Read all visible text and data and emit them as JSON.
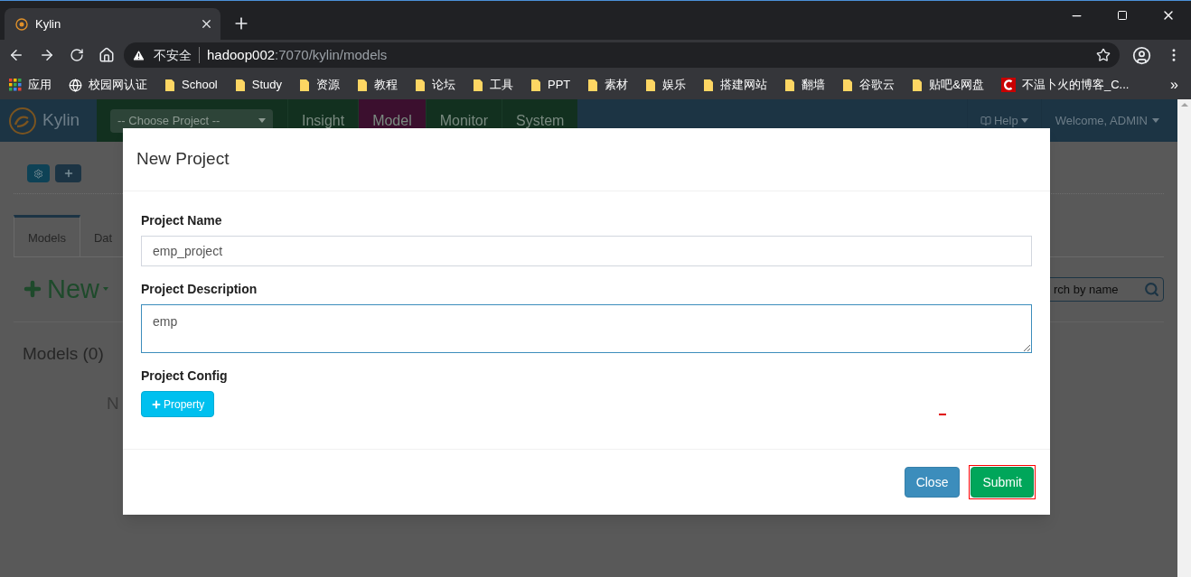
{
  "browser": {
    "tab": {
      "title": "Kylin"
    },
    "address": {
      "security": "不安全",
      "host": "hadoop002",
      "path": ":7070/kylin/models"
    },
    "bookmarks": [
      {
        "label": "应用",
        "kind": "apps"
      },
      {
        "label": "校园网认证",
        "kind": "globe"
      },
      {
        "label": "School",
        "kind": "folder"
      },
      {
        "label": "Study",
        "kind": "folder"
      },
      {
        "label": "资源",
        "kind": "folder"
      },
      {
        "label": "教程",
        "kind": "folder"
      },
      {
        "label": "论坛",
        "kind": "folder"
      },
      {
        "label": "工具",
        "kind": "folder"
      },
      {
        "label": "PPT",
        "kind": "folder"
      },
      {
        "label": "素材",
        "kind": "folder"
      },
      {
        "label": "娱乐",
        "kind": "folder"
      },
      {
        "label": "搭建网站",
        "kind": "folder"
      },
      {
        "label": "翻墙",
        "kind": "folder"
      },
      {
        "label": "谷歌云",
        "kind": "folder"
      },
      {
        "label": "贴吧&网盘",
        "kind": "folder"
      },
      {
        "label": "不温卜火的博客_C...",
        "kind": "csdn"
      }
    ],
    "bookmarks_more": "»"
  },
  "app": {
    "brand": "Kylin",
    "project_select": "-- Choose Project --",
    "nav": [
      {
        "label": "Insight",
        "selected": false
      },
      {
        "label": "Model",
        "selected": true
      },
      {
        "label": "Monitor",
        "selected": false
      },
      {
        "label": "System",
        "selected": false
      }
    ],
    "help": "Help",
    "welcome": "Welcome, ADMIN"
  },
  "page": {
    "tabs": [
      {
        "label": "Models",
        "selected": true
      },
      {
        "label": "Dat",
        "selected": false
      }
    ],
    "new_button": "New",
    "models_heading": "Models (0)",
    "empty_text": "N",
    "search": {
      "placeholder": "rch by name"
    }
  },
  "dialog": {
    "title": "New Project",
    "fields": [
      {
        "label": "Project Name",
        "kind": "input",
        "value": "emp_project",
        "focused": false
      },
      {
        "label": "Project Description",
        "kind": "textarea",
        "value": "emp",
        "focused": true
      }
    ],
    "config_label": "Project Config",
    "property_button": "Property",
    "buttons": [
      {
        "label": "Close",
        "kind": "secondary",
        "highlighted": false
      },
      {
        "label": "Submit",
        "kind": "primary",
        "highlighted": true
      }
    ]
  }
}
